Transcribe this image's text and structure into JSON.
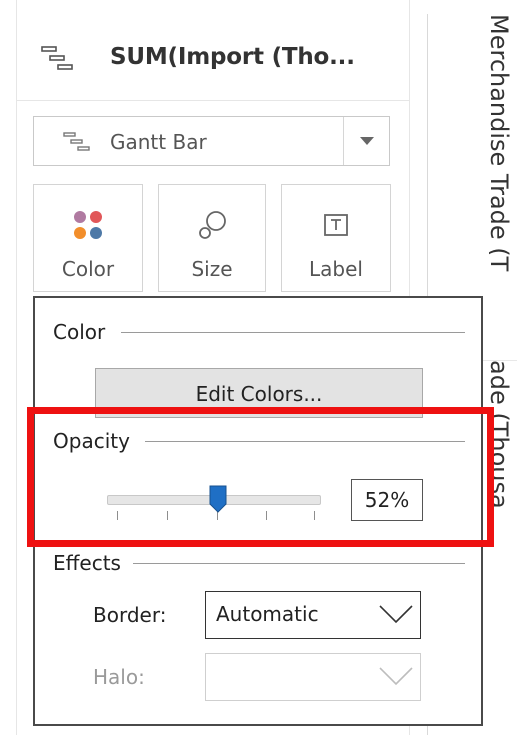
{
  "header": {
    "title": "SUM(Import (Tho...",
    "icon": "gantt-bar-icon"
  },
  "mark_type": {
    "selected": "Gantt Bar",
    "icon": "gantt-bar-icon",
    "arrow_icon": "dropdown-arrow-icon"
  },
  "cards": [
    {
      "label": "Color",
      "icon": "color-dots-icon",
      "dot_colors": [
        "#b07aa1",
        "#e15759",
        "#f28e2b",
        "#4e79a7"
      ]
    },
    {
      "label": "Size",
      "icon": "size-icon"
    },
    {
      "label": "Label",
      "icon": "label-icon"
    }
  ],
  "axis": {
    "title_top": "Merchandise Trade (T",
    "title_bottom": "ade (Thousa"
  },
  "popup": {
    "color_section": "Color",
    "edit_colors_button": "Edit Colors...",
    "opacity_section": "Opacity",
    "opacity_value": "52%",
    "opacity_fraction": 0.52,
    "effects_section": "Effects",
    "border_label": "Border:",
    "border_value": "Automatic",
    "halo_label": "Halo:",
    "halo_value": ""
  },
  "colors": {
    "highlight": "#ee1111",
    "slider_thumb": "#1f6fc5"
  }
}
